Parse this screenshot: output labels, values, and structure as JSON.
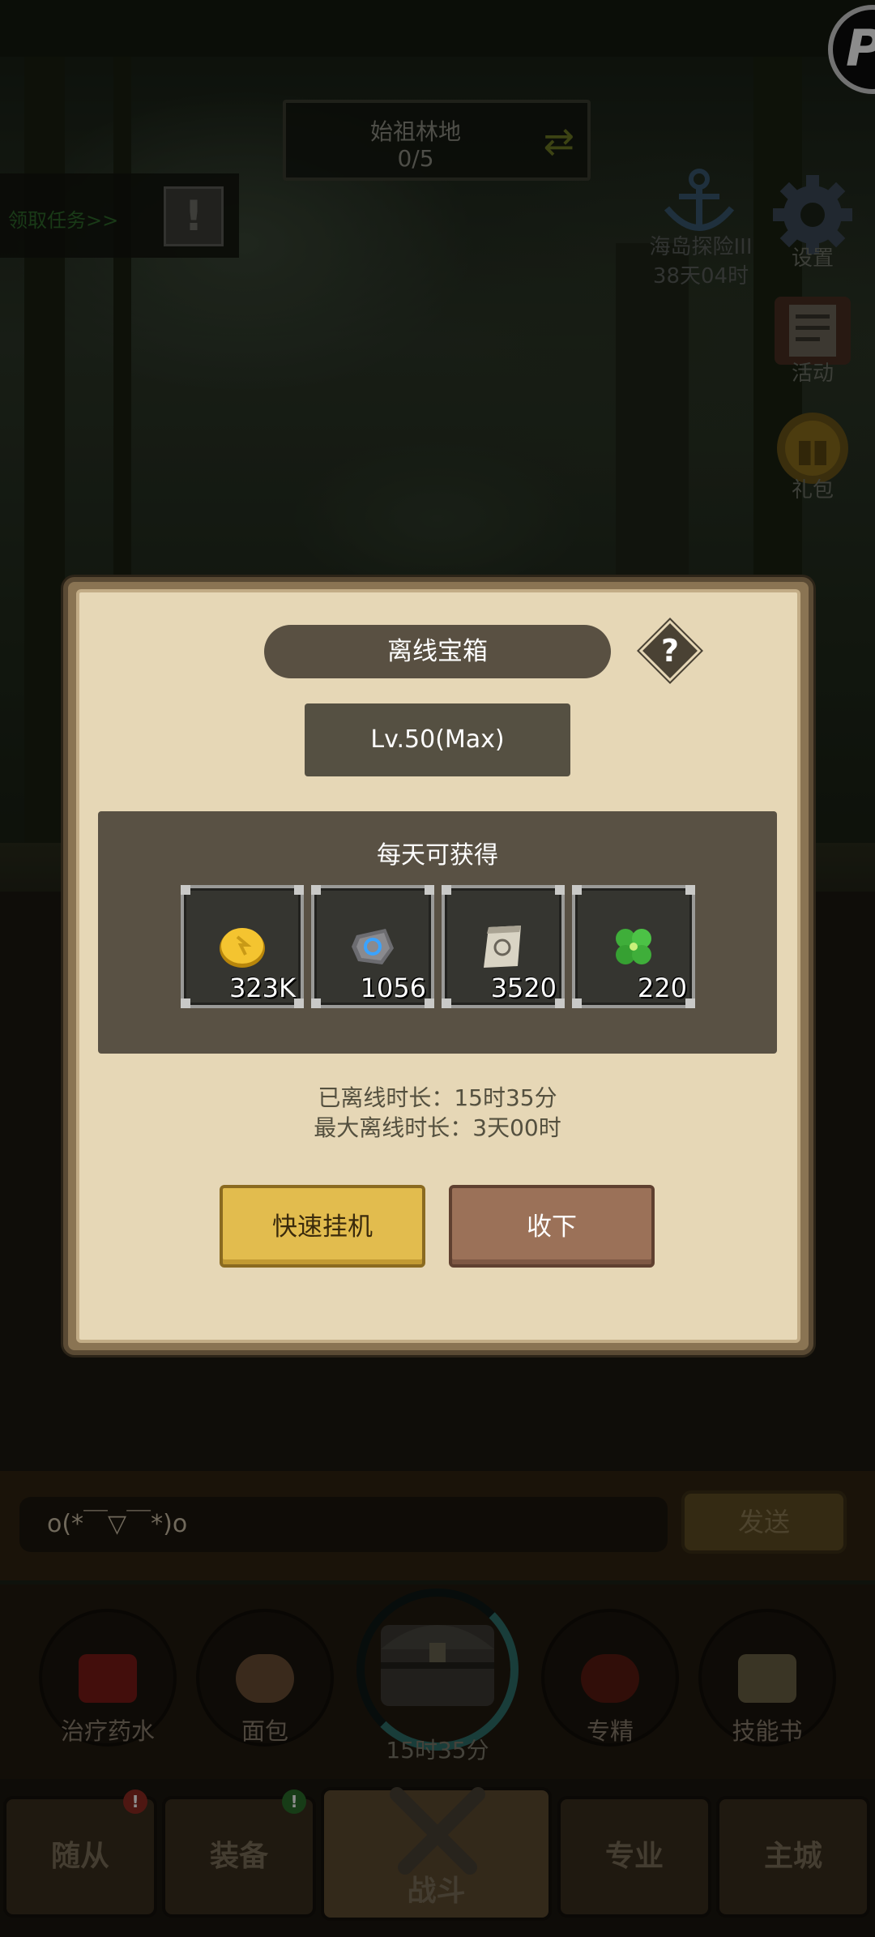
{
  "hud": {
    "location_name": "始祖林地",
    "location_progress": "0/5",
    "quest_link": "领取任务>>",
    "quest_badge": "!",
    "event_name": "海岛探险III",
    "event_time": "38天04时",
    "side_buttons": [
      {
        "label": "设置",
        "icon": "gear-icon"
      },
      {
        "label": "活动",
        "icon": "scroll-board-icon"
      },
      {
        "label": "礼包",
        "icon": "gift-coin-icon"
      }
    ],
    "corner_logo": "P"
  },
  "dialog": {
    "title": "离线宝箱",
    "help": "?",
    "level": "Lv.50(Max)",
    "reward_heading": "每天可获得",
    "rewards": [
      {
        "icon": "gold-coin-icon",
        "count": "323K"
      },
      {
        "icon": "stone-ore-icon",
        "count": "1056"
      },
      {
        "icon": "scroll-icon",
        "count": "3520"
      },
      {
        "icon": "clover-icon",
        "count": "220"
      }
    ],
    "offline_duration": "已离线时长：15时35分",
    "max_offline_duration": "最大离线时长：3天00时",
    "quick_idle_label": "快速挂机",
    "collect_label": "收下"
  },
  "chat": {
    "input_value": "o(*￣▽￣*)o",
    "send_label": "发送"
  },
  "quick_items": [
    {
      "label": "治疗药水",
      "icon": "potion-icon"
    },
    {
      "label": "面包",
      "icon": "bread-icon"
    },
    {
      "label": "15时35分",
      "icon": "treasure-chest-icon"
    },
    {
      "label": "专精",
      "icon": "specialty-icon"
    },
    {
      "label": "技能书",
      "icon": "skill-book-icon"
    }
  ],
  "nav": {
    "tabs": [
      {
        "label": "随从",
        "badge": "!"
      },
      {
        "label": "装备",
        "badge": "!"
      },
      {
        "label": "战斗"
      },
      {
        "label": "专业"
      },
      {
        "label": "主城"
      }
    ]
  },
  "colors": {
    "paper": "#e6d7b6",
    "panel_dark": "#595144",
    "gold_button": "#e2bc4e",
    "brown_button": "#9b7158",
    "badge_red": "#c0392b",
    "badge_green": "#2e9d3a"
  }
}
